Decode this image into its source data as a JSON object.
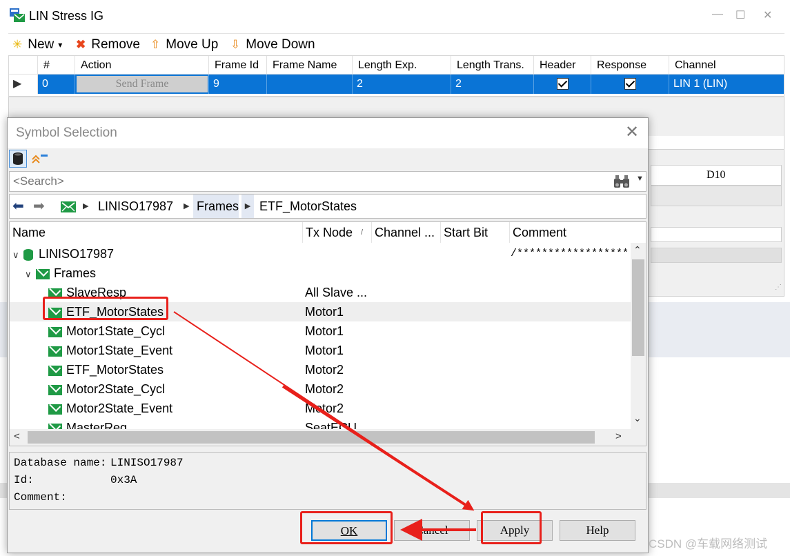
{
  "main": {
    "title": "LIN Stress IG",
    "toolbar": {
      "new_label": "New",
      "new_caret": "▾",
      "remove_label": "Remove",
      "move_up_label": "Move Up",
      "move_down_label": "Move Down"
    },
    "grid": {
      "columns": [
        "#",
        "Action",
        "Frame Id",
        "Frame Name",
        "Length Exp.",
        "Length Trans.",
        "Header",
        "Response",
        "Channel"
      ],
      "row": {
        "index": "0",
        "action": "Send Frame",
        "frame_id": "9",
        "frame_name": "",
        "length_exp": "2",
        "length_trans": "2",
        "header": true,
        "response": true,
        "channel": "LIN 1 (LIN)"
      }
    },
    "side_label": "D10"
  },
  "dialog": {
    "title": "Symbol Selection",
    "close_glyph": "✕",
    "search_placeholder": "<Search>",
    "breadcrumb": [
      "LINISO17987",
      "Frames",
      "ETF_MotorStates"
    ],
    "columns": [
      "Name",
      "Tx Node",
      "Channel ...",
      "Start Bit",
      "Comment"
    ],
    "tree": {
      "database": "LINISO17987",
      "database_comment": "/******************",
      "folder": "Frames",
      "frames": [
        {
          "name": "SlaveResp",
          "tx_node": "All Slave ..."
        },
        {
          "name": "ETF_MotorStates",
          "tx_node": "Motor1"
        },
        {
          "name": "Motor1State_Cycl",
          "tx_node": "Motor1"
        },
        {
          "name": "Motor1State_Event",
          "tx_node": "Motor1"
        },
        {
          "name": "ETF_MotorStates",
          "tx_node": "Motor2"
        },
        {
          "name": "Motor2State_Cycl",
          "tx_node": "Motor2"
        },
        {
          "name": "Motor2State_Event",
          "tx_node": "Motor2"
        },
        {
          "name": "MasterReq",
          "tx_node": "SeatECU"
        }
      ]
    },
    "details": {
      "db_label": "Database name:",
      "db_value": "LINISO17987",
      "id_label": "Id:",
      "id_value": "0x3A",
      "comment_label": "Comment:",
      "comment_value": ""
    },
    "buttons": {
      "ok": "OK",
      "cancel": "Cancel",
      "apply": "Apply",
      "help": "Help"
    }
  },
  "watermark": "CSDN @车载网络测试",
  "colors": {
    "selection_blue": "#0a74d6",
    "annotation_red": "#e8201b",
    "frame_icon_green": "#1f9a45"
  }
}
